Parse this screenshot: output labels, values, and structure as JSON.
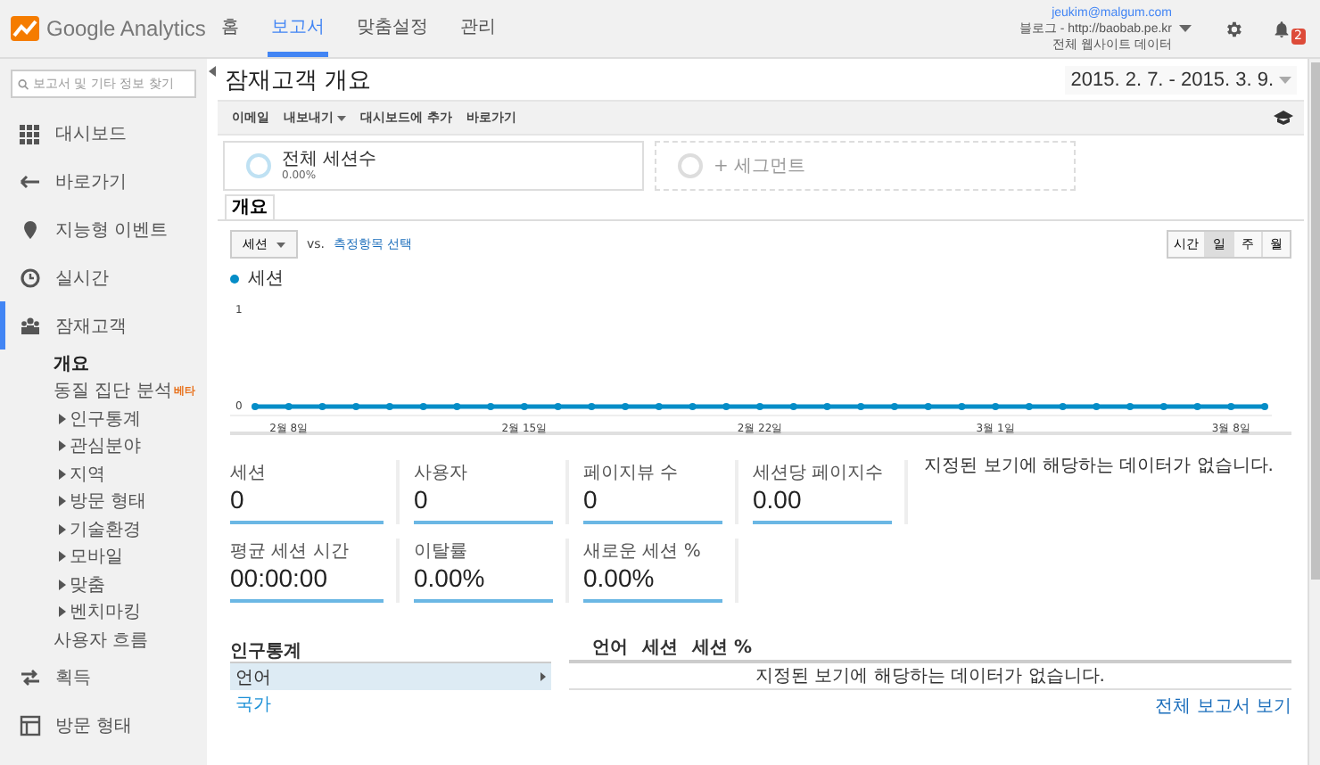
{
  "header": {
    "logo_text": "Google Analytics",
    "nav": [
      {
        "label": "홈",
        "selected": false
      },
      {
        "label": "보고서",
        "selected": true
      },
      {
        "label": "맞춤설정",
        "selected": false
      },
      {
        "label": "관리",
        "selected": false
      }
    ],
    "account": {
      "email": "jeukim@malgum.com",
      "property": "블로그 - http://baobab.pe.kr",
      "view": "전체 웹사이트 데이터"
    },
    "notification_count": "2"
  },
  "sidebar": {
    "search": {
      "placeholder": "보고서 및 기타 정보 찾기"
    },
    "items": [
      {
        "label": "대시보드",
        "selected": false
      },
      {
        "label": "바로가기",
        "selected": false
      },
      {
        "label": "지능형 이벤트",
        "selected": false
      },
      {
        "label": "실시간",
        "selected": false
      },
      {
        "label": "잠재고객",
        "selected": true,
        "children": [
          {
            "kind": "link",
            "label": "개요",
            "selected": true
          },
          {
            "kind": "link",
            "label": "동질 집단 분석",
            "badge": "베타",
            "selected": false
          },
          {
            "kind": "group",
            "label": "인구통계",
            "expanded": false,
            "selected": false
          },
          {
            "kind": "group",
            "label": "관심분야",
            "expanded": false,
            "selected": false
          },
          {
            "kind": "group",
            "label": "지역",
            "expanded": false,
            "selected": false
          },
          {
            "kind": "group",
            "label": "방문 형태",
            "expanded": false,
            "selected": false
          },
          {
            "kind": "group",
            "label": "기술환경",
            "expanded": false,
            "selected": false
          },
          {
            "kind": "group",
            "label": "모바일",
            "expanded": false,
            "selected": false
          },
          {
            "kind": "group",
            "label": "맞춤",
            "expanded": false,
            "selected": false
          },
          {
            "kind": "group",
            "label": "벤치마킹",
            "expanded": false,
            "selected": false
          },
          {
            "kind": "link",
            "label": "사용자 흐름",
            "selected": false
          }
        ]
      },
      {
        "label": "획득",
        "selected": false
      },
      {
        "label": "방문 형태",
        "selected": false
      }
    ]
  },
  "page": {
    "title": "잠재고객 개요",
    "date_range": "2015. 2. 7. - 2015. 3. 9.",
    "toolbar": [
      {
        "label": "이메일",
        "dropdown": false
      },
      {
        "label": "내보내기",
        "dropdown": true
      },
      {
        "label": "대시보드에 추가",
        "dropdown": false
      },
      {
        "label": "바로가기",
        "dropdown": false
      }
    ],
    "segments": [
      {
        "kind": "segment",
        "name": "전체 세션수",
        "percent": "0.00%"
      },
      {
        "kind": "add",
        "name": "+ 세그먼트"
      }
    ],
    "tabs": [
      {
        "label": "개요",
        "selected": true
      }
    ],
    "metric_select": "세션",
    "vs": "vs.",
    "compare_link": "측정항목 선택",
    "granularity": [
      {
        "label": "시간",
        "selected": false
      },
      {
        "label": "일",
        "selected": true
      },
      {
        "label": "주",
        "selected": false
      },
      {
        "label": "월",
        "selected": false
      }
    ],
    "chart_data": {
      "type": "line",
      "categories": [
        null,
        "2월 8일",
        null,
        null,
        null,
        null,
        null,
        null,
        "2월 15일",
        null,
        null,
        null,
        null,
        null,
        null,
        "2월 22일",
        null,
        null,
        null,
        null,
        null,
        null,
        "3월 1일",
        null,
        null,
        null,
        null,
        null,
        null,
        "3월 8일",
        null
      ],
      "series": [
        {
          "name": "세션",
          "color": "#058dc7",
          "marker": true,
          "values": [
            0,
            0,
            0,
            0,
            0,
            0,
            0,
            0,
            0,
            0,
            0,
            0,
            0,
            0,
            0,
            0,
            0,
            0,
            0,
            0,
            0,
            0,
            0,
            0,
            0,
            0,
            0,
            0,
            0,
            0,
            0
          ]
        }
      ],
      "yticks": [
        0,
        1
      ],
      "ylim": [
        0,
        1
      ]
    },
    "metrics": [
      {
        "label": "세션",
        "value": "0"
      },
      {
        "label": "사용자",
        "value": "0"
      },
      {
        "label": "페이지뷰 수",
        "value": "0"
      },
      {
        "label": "세션당 페이지수",
        "value": "0.00"
      },
      {
        "label": "평균 세션 시간",
        "value": "00:00:00"
      },
      {
        "label": "이탈률",
        "value": "0.00%"
      },
      {
        "label": "새로운 세션 %",
        "value": "0.00%"
      }
    ],
    "no_data_message": "지정된 보기에 해당하는 데이터가 없습니다.",
    "demographics": {
      "title": "인구통계",
      "rows": [
        {
          "label": "언어",
          "selected": true
        },
        {
          "label": "국가",
          "selected": false
        }
      ]
    },
    "detail": {
      "title": "언어",
      "columns": [
        "세션",
        "세션 %"
      ],
      "message": "지정된 보기에 해당하는 데이터가 없습니다.",
      "link": "전체 보고서 보기"
    }
  }
}
